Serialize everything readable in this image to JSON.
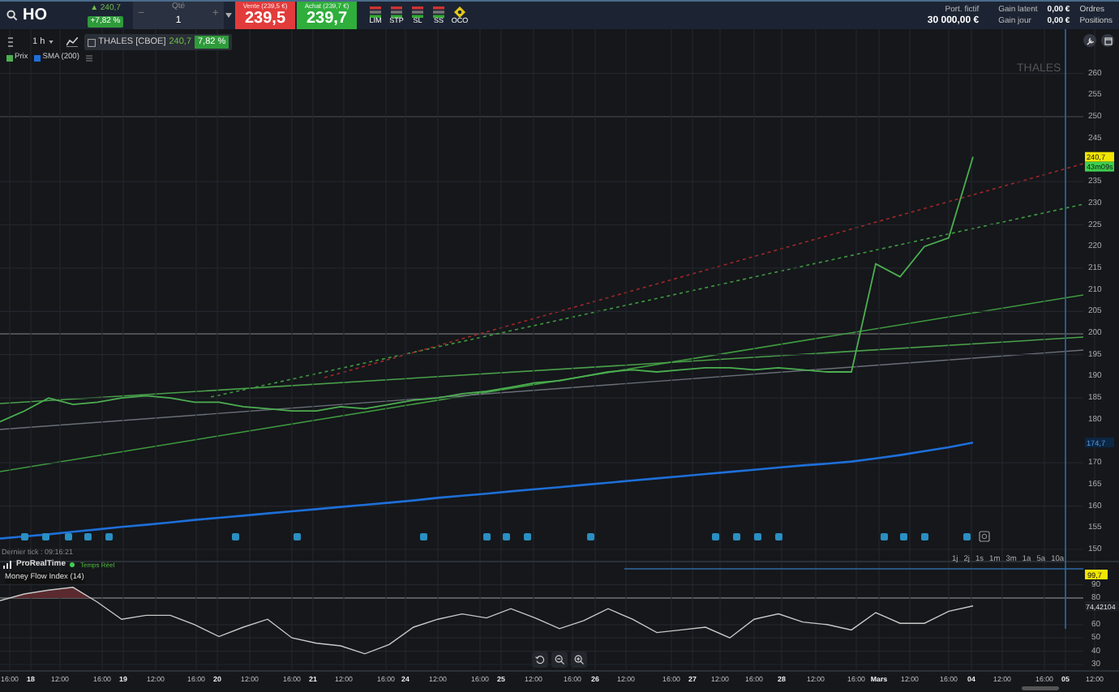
{
  "top_bar": {
    "symbol": "HO",
    "quote": {
      "last": "▲ 240,7",
      "change": "+7,82 %"
    },
    "quantity": {
      "minus": "−",
      "label": "Qté",
      "value": "1",
      "plus": "+"
    },
    "sell": {
      "label": "Vente (239,5 €)",
      "price": "239,5"
    },
    "buy": {
      "label": "Achat (239,7 €)",
      "price": "239,7"
    },
    "order_types": [
      "LIM",
      "STP",
      "SL",
      "SS",
      "OCO"
    ],
    "account": {
      "portfolio_label": "Port. fictif",
      "portfolio_value": "30 000,00 €",
      "latent_label": "Gain latent",
      "day_label": "Gain jour",
      "latent_value": "0,00 €",
      "day_value": "0,00 €",
      "orders": "Ordres",
      "positions": "Positions"
    }
  },
  "chart_toolbar": {
    "interval": "1 h",
    "instrument": "THALES [CBOE]",
    "last": "240,7",
    "change": "7,82 %"
  },
  "chart_label": "THALES",
  "price_labels": [
    {
      "kind": "last",
      "text": "240,7"
    },
    {
      "kind": "countdown",
      "text": "43m09s"
    },
    {
      "kind": "sma",
      "text": "174,7"
    }
  ],
  "main_chart": {
    "chart_data": {
      "type": "line",
      "grid": true,
      "ylim": [
        150,
        260
      ],
      "yticks": [
        150,
        155,
        160,
        165,
        170,
        180,
        185,
        190,
        195,
        200,
        205,
        210,
        215,
        220,
        225,
        230,
        235,
        245,
        250,
        255,
        260
      ],
      "series": [
        {
          "name": "Prix",
          "color": "#4caf50",
          "values": [
            179.5,
            182,
            185,
            183.5,
            184,
            185,
            185.5,
            185,
            184,
            184,
            183,
            182.5,
            182,
            182,
            183,
            182.5,
            183.5,
            184.5,
            185,
            186,
            186.5,
            187.5,
            188.5,
            189,
            190,
            191,
            191.5,
            191,
            191.5,
            192,
            192,
            191.5,
            192,
            191.5,
            191,
            191,
            216,
            213,
            220,
            222,
            240.7
          ]
        },
        {
          "name": "SMA (200)",
          "color": "#1e6fd9",
          "values": [
            152.5,
            153,
            153.5,
            154.1,
            154.6,
            155.2,
            155.7,
            156.2,
            156.8,
            157.3,
            157.8,
            158.3,
            158.8,
            159.3,
            159.8,
            160.3,
            160.8,
            161.3,
            161.9,
            162.4,
            162.9,
            163.4,
            163.9,
            164.4,
            164.9,
            165.4,
            165.9,
            166.4,
            166.9,
            167.4,
            167.9,
            168.4,
            168.9,
            169.4,
            169.8,
            170.3,
            171,
            171.8,
            172.7,
            173.6,
            174.7
          ]
        }
      ]
    }
  },
  "status": {
    "last_tick": "Dernier tick : 09:16:21",
    "brand": "ProRealTime",
    "feed": "Temps Réel"
  },
  "periods": [
    "1j",
    "2j",
    "1s",
    "1m",
    "3m",
    "1a",
    "5a",
    "10a"
  ],
  "indicator": {
    "last_label": "99,7",
    "value_label": "74,42104",
    "chart_data": {
      "type": "line",
      "grid": true,
      "ylim": [
        30,
        90
      ],
      "yticks": [
        30,
        40,
        50,
        60,
        80,
        90
      ],
      "series": [
        {
          "name": "Money Flow Index (14)",
          "color": "#c8c8c8",
          "values": [
            78,
            83,
            86,
            88,
            77,
            64,
            67,
            67,
            60,
            51,
            58,
            64,
            50,
            46,
            44,
            38,
            45,
            58,
            64,
            68,
            65,
            72,
            65,
            57,
            63,
            72,
            64,
            54,
            56,
            58,
            50,
            64,
            68,
            62,
            60,
            56,
            69,
            61,
            61,
            70,
            74
          ]
        }
      ]
    }
  },
  "time_axis": [
    {
      "label": "16:00",
      "kind": "hour"
    },
    {
      "label": "18",
      "kind": "day"
    },
    {
      "label": "12:00",
      "kind": "hour"
    },
    {
      "label": "16:00",
      "kind": "hour"
    },
    {
      "label": "19",
      "kind": "day"
    },
    {
      "label": "12:00",
      "kind": "hour"
    },
    {
      "label": "16:00",
      "kind": "hour"
    },
    {
      "label": "20",
      "kind": "day"
    },
    {
      "label": "12:00",
      "kind": "hour"
    },
    {
      "label": "16:00",
      "kind": "hour"
    },
    {
      "label": "21",
      "kind": "day"
    },
    {
      "label": "12:00",
      "kind": "hour"
    },
    {
      "label": "16:00",
      "kind": "hour"
    },
    {
      "label": "24",
      "kind": "day"
    },
    {
      "label": "12:00",
      "kind": "hour"
    },
    {
      "label": "16:00",
      "kind": "hour"
    },
    {
      "label": "25",
      "kind": "day"
    },
    {
      "label": "12:00",
      "kind": "hour"
    },
    {
      "label": "16:00",
      "kind": "hour"
    },
    {
      "label": "26",
      "kind": "day"
    },
    {
      "label": "12:00",
      "kind": "hour"
    },
    {
      "label": "16:00",
      "kind": "hour"
    },
    {
      "label": "27",
      "kind": "day"
    },
    {
      "label": "12:00",
      "kind": "hour"
    },
    {
      "label": "16:00",
      "kind": "hour"
    },
    {
      "label": "28",
      "kind": "day"
    },
    {
      "label": "12:00",
      "kind": "hour"
    },
    {
      "label": "16:00",
      "kind": "hour"
    },
    {
      "label": "Mars",
      "kind": "day"
    },
    {
      "label": "12:00",
      "kind": "hour"
    },
    {
      "label": "16:00",
      "kind": "hour"
    },
    {
      "label": "04",
      "kind": "day"
    },
    {
      "label": "12:00",
      "kind": "hour"
    },
    {
      "label": "16:00",
      "kind": "hour"
    },
    {
      "label": "05",
      "kind": "day"
    },
    {
      "label": "12:00",
      "kind": "hour"
    }
  ]
}
